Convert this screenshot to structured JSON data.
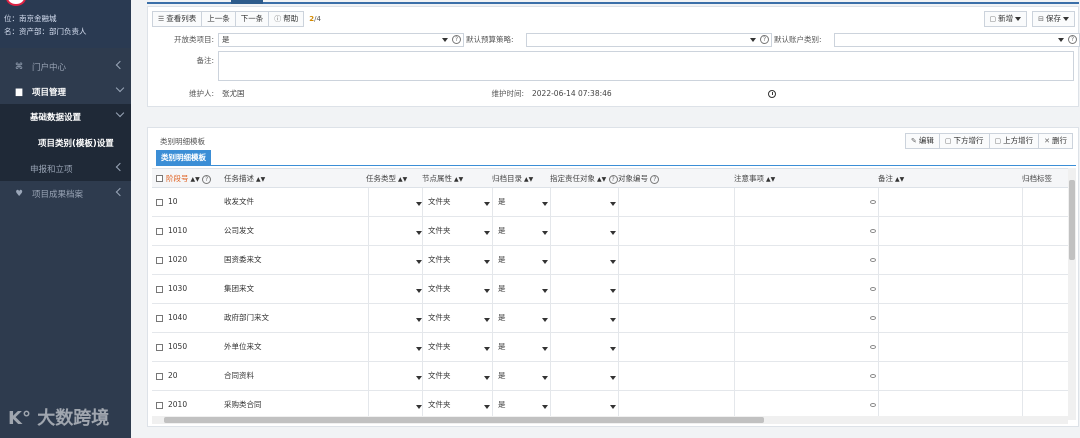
{
  "sidebar": {
    "user_line1": "位：南京金融城",
    "user_line2": "名：资产部：部门负责人",
    "items": [
      {
        "label": "门户中心"
      },
      {
        "label": "项目管理"
      },
      {
        "label": "基础数据设置"
      },
      {
        "label": "项目类别(模板)设置"
      },
      {
        "label": "申报和立项"
      },
      {
        "label": "项目成果档案"
      }
    ],
    "logo_text": "大数跨境"
  },
  "toolbar": {
    "view_list": "查看列表",
    "prev": "上一条",
    "next": "下一条",
    "help": "帮助",
    "pager_current": "2",
    "pager_total": "/4",
    "new": "新增",
    "save": "保存"
  },
  "form": {
    "open_label": "开放类项目:",
    "open_value": "是",
    "budget_label": "默认预算策略:",
    "budget_value": "",
    "account_label": "默认账户类别:",
    "account_value": "",
    "remark_label": "备注:",
    "remark_value": "",
    "maintainer_label": "维护人:",
    "maintainer_value": "张尤国",
    "maintain_time_label": "维护时间:",
    "maintain_time_value": "2022-06-14 07:38:46"
  },
  "grid": {
    "panel_title": "类别明细模板",
    "tab_label": "类别明细模板",
    "tools": {
      "edit": "编辑",
      "insert_below": "下方增行",
      "insert_above": "上方增行",
      "delete": "删行"
    },
    "columns": [
      "阶段号",
      "任务描述",
      "任务类型",
      "节点属性",
      "归档目录",
      "指定责任对象",
      "对象编号",
      "注意事项",
      "备注",
      "归档标签"
    ],
    "rows": [
      {
        "code": "10",
        "desc": "收发文件",
        "node": "文件夹",
        "archive": "是"
      },
      {
        "code": "1010",
        "desc": "公司发文",
        "node": "文件夹",
        "archive": "是"
      },
      {
        "code": "1020",
        "desc": "国资委来文",
        "node": "文件夹",
        "archive": "是"
      },
      {
        "code": "1030",
        "desc": "集团来文",
        "node": "文件夹",
        "archive": "是"
      },
      {
        "code": "1040",
        "desc": "政府部门来文",
        "node": "文件夹",
        "archive": "是"
      },
      {
        "code": "1050",
        "desc": "外单位来文",
        "node": "文件夹",
        "archive": "是"
      },
      {
        "code": "20",
        "desc": "合同资料",
        "node": "文件夹",
        "archive": "是"
      },
      {
        "code": "2010",
        "desc": "采购类合同",
        "node": "文件夹",
        "archive": "是"
      }
    ]
  },
  "colors": {
    "sidebar_bg": "#2e3b4e",
    "accent": "#3b8ed6",
    "pager": "#d48a00"
  }
}
